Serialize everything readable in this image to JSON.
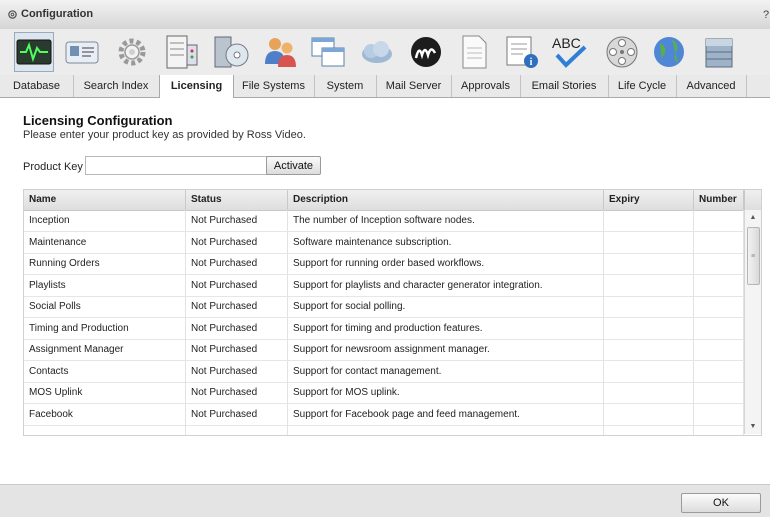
{
  "window": {
    "title": "Configuration",
    "help_label": "?"
  },
  "toolbar_icons": [
    "monitor-icon",
    "card-icon",
    "gear-icon",
    "server-icon",
    "disc-icon",
    "users-icon",
    "windows-icon",
    "cloud-icon",
    "script-m-icon",
    "document-icon",
    "calendar-info-icon",
    "spellcheck-icon",
    "film-reel-icon",
    "globe-icon",
    "archive-icon"
  ],
  "tabs": [
    "Database",
    "Search Index",
    "Licensing",
    "File Systems",
    "System",
    "Mail Server",
    "Approvals",
    "Email Stories",
    "Life Cycle",
    "Advanced"
  ],
  "active_tab": "Licensing",
  "licensing": {
    "heading": "Licensing Configuration",
    "instructions": "Please enter your product key as provided by Ross Video.",
    "product_key_label": "Product Key",
    "product_key_value": "",
    "activate_label": "Activate"
  },
  "table": {
    "columns": [
      "Name",
      "Status",
      "Description",
      "Expiry",
      "Number"
    ],
    "rows": [
      [
        "Inception",
        "Not Purchased",
        "The number of Inception software nodes.",
        "",
        ""
      ],
      [
        "Maintenance",
        "Not Purchased",
        "Software maintenance subscription.",
        "",
        ""
      ],
      [
        "Running Orders",
        "Not Purchased",
        "Support for running order based workflows.",
        "",
        ""
      ],
      [
        "Playlists",
        "Not Purchased",
        "Support for playlists and character generator integration.",
        "",
        ""
      ],
      [
        "Social Polls",
        "Not Purchased",
        "Support for social polling.",
        "",
        ""
      ],
      [
        "Timing and Production",
        "Not Purchased",
        "Support for timing and production features.",
        "",
        ""
      ],
      [
        "Assignment Manager",
        "Not Purchased",
        "Support for newsroom assignment manager.",
        "",
        ""
      ],
      [
        "Contacts",
        "Not Purchased",
        "Support for contact management.",
        "",
        ""
      ],
      [
        "MOS Uplink",
        "Not Purchased",
        "Support for MOS uplink.",
        "",
        ""
      ],
      [
        "Facebook",
        "Not Purchased",
        "Support for Facebook page and feed management.",
        "",
        ""
      ]
    ]
  },
  "footer": {
    "ok_label": "OK"
  }
}
